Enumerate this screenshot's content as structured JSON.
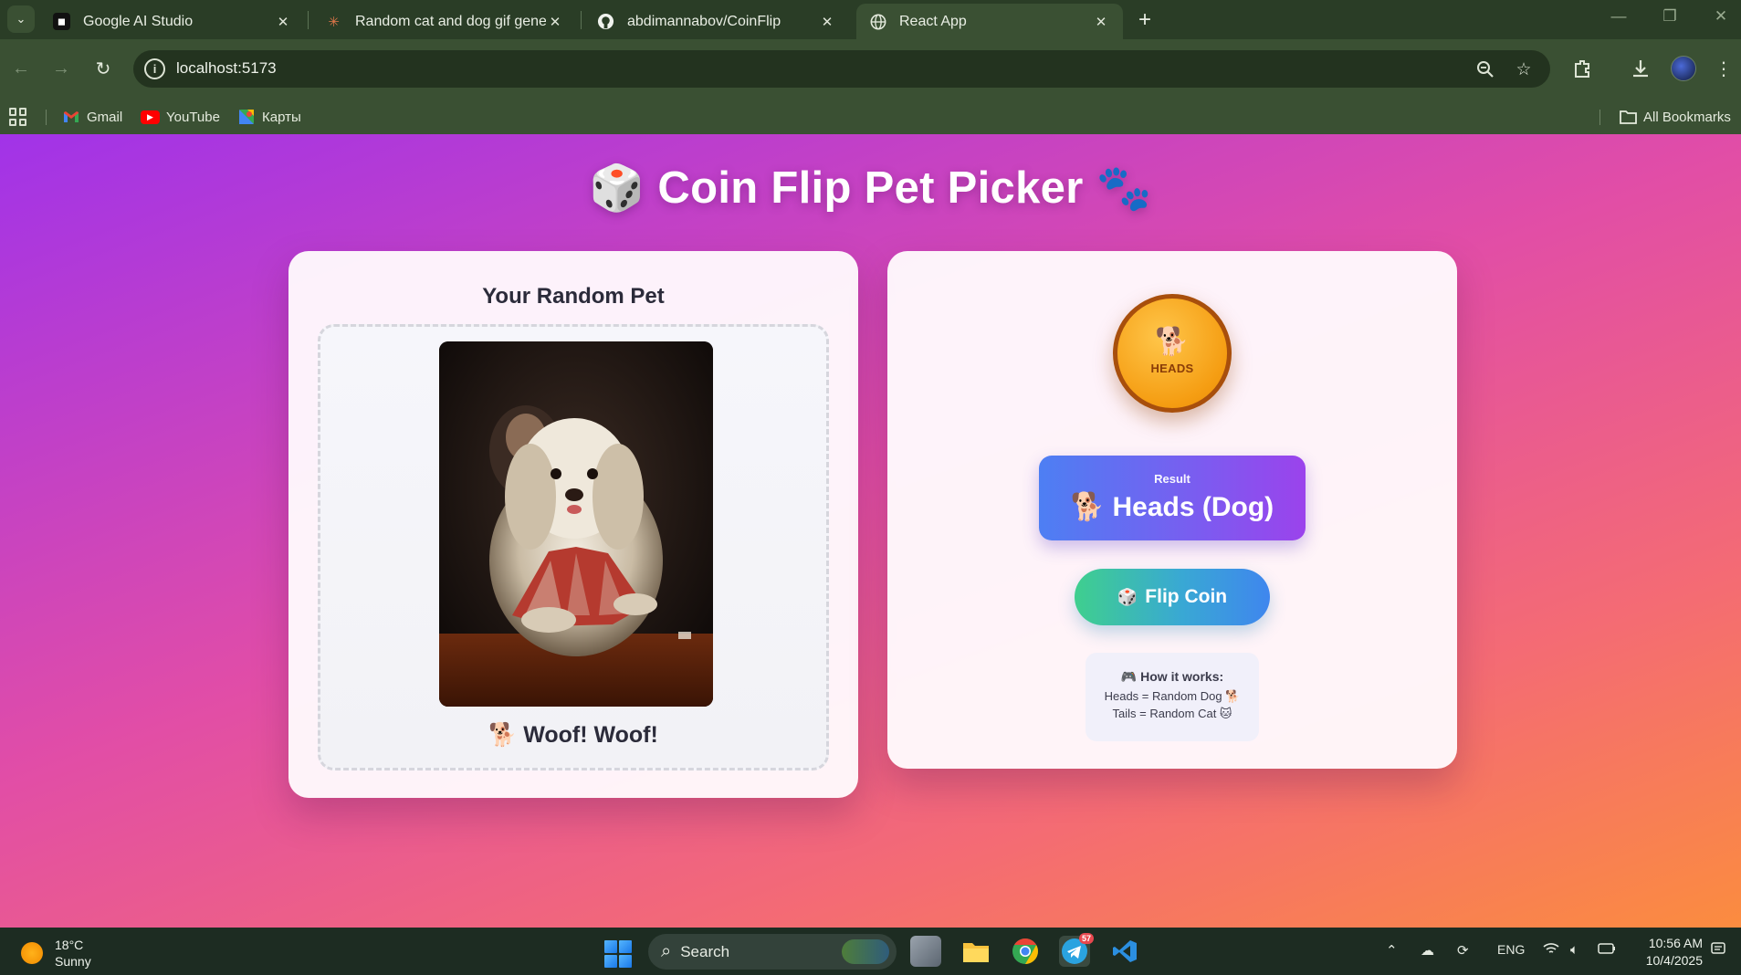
{
  "browser": {
    "tabs": [
      {
        "title": "Google AI Studio",
        "icon": "google-ai-studio-icon",
        "active": false
      },
      {
        "title": "Random cat and dog gif genera",
        "icon": "claude-icon",
        "active": false
      },
      {
        "title": "abdimannabov/CoinFlip",
        "icon": "github-icon",
        "active": false
      },
      {
        "title": "React App",
        "icon": "globe-icon",
        "active": true
      }
    ],
    "address": "localhost:5173",
    "bookmarks": [
      {
        "label": "Gmail",
        "icon": "gmail-icon"
      },
      {
        "label": "YouTube",
        "icon": "youtube-icon"
      },
      {
        "label": "Карты",
        "icon": "maps-icon"
      }
    ],
    "all_bookmarks_label": "All Bookmarks"
  },
  "app": {
    "title": "Coin Flip Pet Picker",
    "title_icon_left": "🎲",
    "title_icon_right": "🐾",
    "pet_card": {
      "heading": "Your Random Pet",
      "caption": "🐕 Woof! Woof!",
      "image_alt": "shaggy white dog holding playing cards"
    },
    "coin": {
      "icon": "🐕",
      "label": "HEADS"
    },
    "result": {
      "label": "Result",
      "value": "🐕 Heads (Dog)"
    },
    "flip_button": {
      "icon": "🎲",
      "label": "Flip Coin"
    },
    "how_it_works": {
      "title": "🎮 How it works:",
      "line1": "Heads = Random Dog 🐕",
      "line2": "Tails = Random Cat 🐱"
    }
  },
  "taskbar": {
    "weather_temp": "18°C",
    "weather_condition": "Sunny",
    "search_label": "Search",
    "language": "ENG",
    "telegram_badge": "57",
    "time": "10:56 AM",
    "date": "10/4/2025"
  },
  "colors": {
    "page_gradient_start": "#a133e8",
    "page_gradient_end": "#fb8c3f",
    "coin": "#f59d12",
    "result_gradient": "#4d7ff3",
    "flip_gradient": "#3fcf8e"
  }
}
